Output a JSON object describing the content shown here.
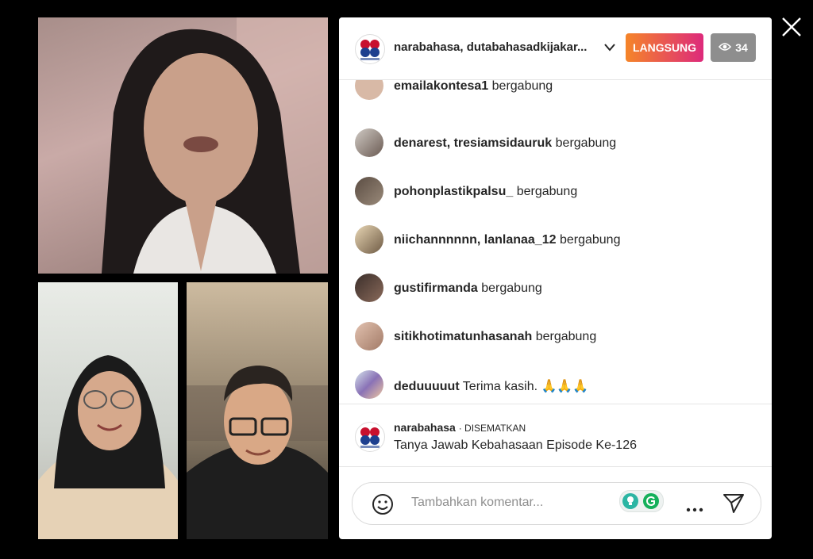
{
  "live": {
    "host_title": "narabahasa, dutabahasadkijakar...",
    "live_label": "LANGSUNG",
    "viewer_count": "34",
    "accent_colors": [
      "#f58529",
      "#dd2a7b"
    ]
  },
  "comments": [
    {
      "user": "emailakontesa1",
      "text": "bergabung"
    },
    {
      "user": "denarest, tresiamsidauruk",
      "text": "bergabung"
    },
    {
      "user": "pohonplastikpalsu_",
      "text": "bergabung"
    },
    {
      "user": "niichannnnnn, lanlanaa_12",
      "text": "bergabung"
    },
    {
      "user": "gustifirmanda",
      "text": "bergabung"
    },
    {
      "user": "sitikhotimatunhasanah",
      "text": "bergabung"
    },
    {
      "user": "deduuuuut",
      "text": "Terima kasih. 🙏🙏🙏"
    }
  ],
  "pinned": {
    "user": "narabahasa",
    "tag": "· DISEMATKAN",
    "text": "Tanya Jawab Kebahasaan Episode Ke-126"
  },
  "composer": {
    "placeholder": "Tambahkan komentar..."
  },
  "logo": {
    "caption": "Narabahasa"
  }
}
